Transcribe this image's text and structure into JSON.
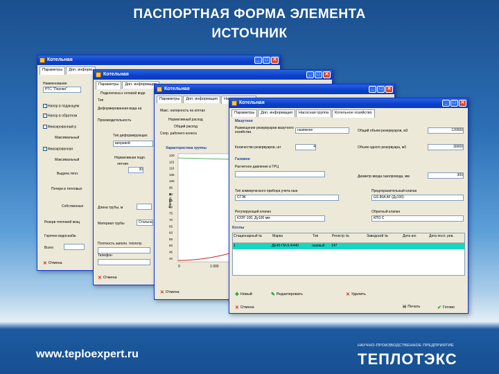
{
  "title_line1": "ПАСПОРТНАЯ ФОРМА ЭЛЕМЕНТА",
  "title_line2": "ИСТОЧНИК",
  "window_title": "Котельная",
  "tabs": {
    "params": "Параметры",
    "extra": "Доп. информация",
    "pumps": "Насосная группа",
    "boiler": "Котельное хозяйство"
  },
  "w1": {
    "tabs": [
      "Параметры",
      "Доп. информ."
    ],
    "name_label": "Наименование",
    "name_value": "РТС \"Перово\"",
    "checks": [
      "Напор в подающем",
      "Напор в обратном",
      "Фиксированный р",
      "",
      "Фиксированная"
    ],
    "max_label": "Максимальный",
    "max_label2": "Максимальный",
    "out_label": "Выдача тепл.",
    "loss_label": "Потери в тепловых",
    "own_label": "Собственные",
    "reserve_label": "Резерв тепловой мощ.",
    "burn_label": "Горячее водоснабж.",
    "total_label": "Всего",
    "cancel": "Отмена"
  },
  "w2": {
    "connect": "Подключена к сетевой воде",
    "type_label": "Тип",
    "type_val": "Деформированная вода на",
    "pipe_len": "Длина трубы, м",
    "mat_label": "Материал трубы",
    "mat_val": "Стальная",
    "rough": "Плотность заполн. теплотр.",
    "phone": "Телефон",
    "cancel": "Отмена",
    "press": "Производительность",
    "defs": "Тип деформирующих",
    "defs_val": "вихревой",
    "norm": "Нормативная подп.",
    "norm_val": "летняя",
    "num": "30"
  },
  "w3": {
    "head_label": "Макс. напорность на котлах",
    "norm_label": "Нормативный расход",
    "total_label": "Общий расход",
    "sel_label": "Сопр. рабочего колеса",
    "cancel": "Отмена",
    "chart_title": "Характеристика группы",
    "ylabel": "Напор, м",
    "yticks": [
      "120",
      "115",
      "110",
      "105",
      "100",
      "95",
      "90",
      "85",
      "80",
      "75",
      "70",
      "65",
      "60",
      "55",
      "50",
      "45",
      "40"
    ],
    "xticks": [
      "0",
      "1 000"
    ]
  },
  "w4": {
    "section1": "Мазутное",
    "placement_label": "Размещение резервуаров мазутного хозяйства",
    "placement_val": "наземное",
    "total_vol_label": "Общий объем резервуаров, м3",
    "total_vol": "120000",
    "count_label": "Количество резервуаров, шт",
    "count_val": "4",
    "one_vol_label": "Объем одного резервуара, м3",
    "one_vol": "30000",
    "section2": "Газовое",
    "pressure_label": "Расчетное давление в ГРЦ",
    "diam_label": "Диаметр ввода газопровода, мм",
    "diam_val": "300",
    "meter_label": "Тип коммерческого прибора учета газа",
    "meter_val": "СГЭК",
    "valve_label": "Предохранительный клапан",
    "valve_val": "GS 80A AF (Ду100)",
    "reg_label": "Регулирующий клапан",
    "reg_val": "КЗЭГ-100, Ду100 мм",
    "check_label": "Обратный клапан",
    "check_val": "КПО С",
    "section3": "Котлы",
    "table_headers": [
      "Стационарный №",
      "Марка",
      "Тип",
      "Регистр №",
      "Заводской №",
      "Дата изг.",
      "Дата посл. рев."
    ],
    "row": [
      "1",
      "ДЕ45-ГМ-9.4/440",
      "газовый",
      "147",
      "",
      "",
      ""
    ],
    "new_btn": "Новый",
    "edit_btn": "Редактировать",
    "del_btn": "Удалить",
    "cancel": "Отмена",
    "print": "Печать",
    "ok": "Готово"
  },
  "footer_url": "www.teploexpert.ru",
  "footer_tag": "НАУЧНО-ПРОИЗВОДСТВЕННОЕ ПРЕДПРИЯТИЕ",
  "footer_logo": "ТЕПЛОТЭКС"
}
